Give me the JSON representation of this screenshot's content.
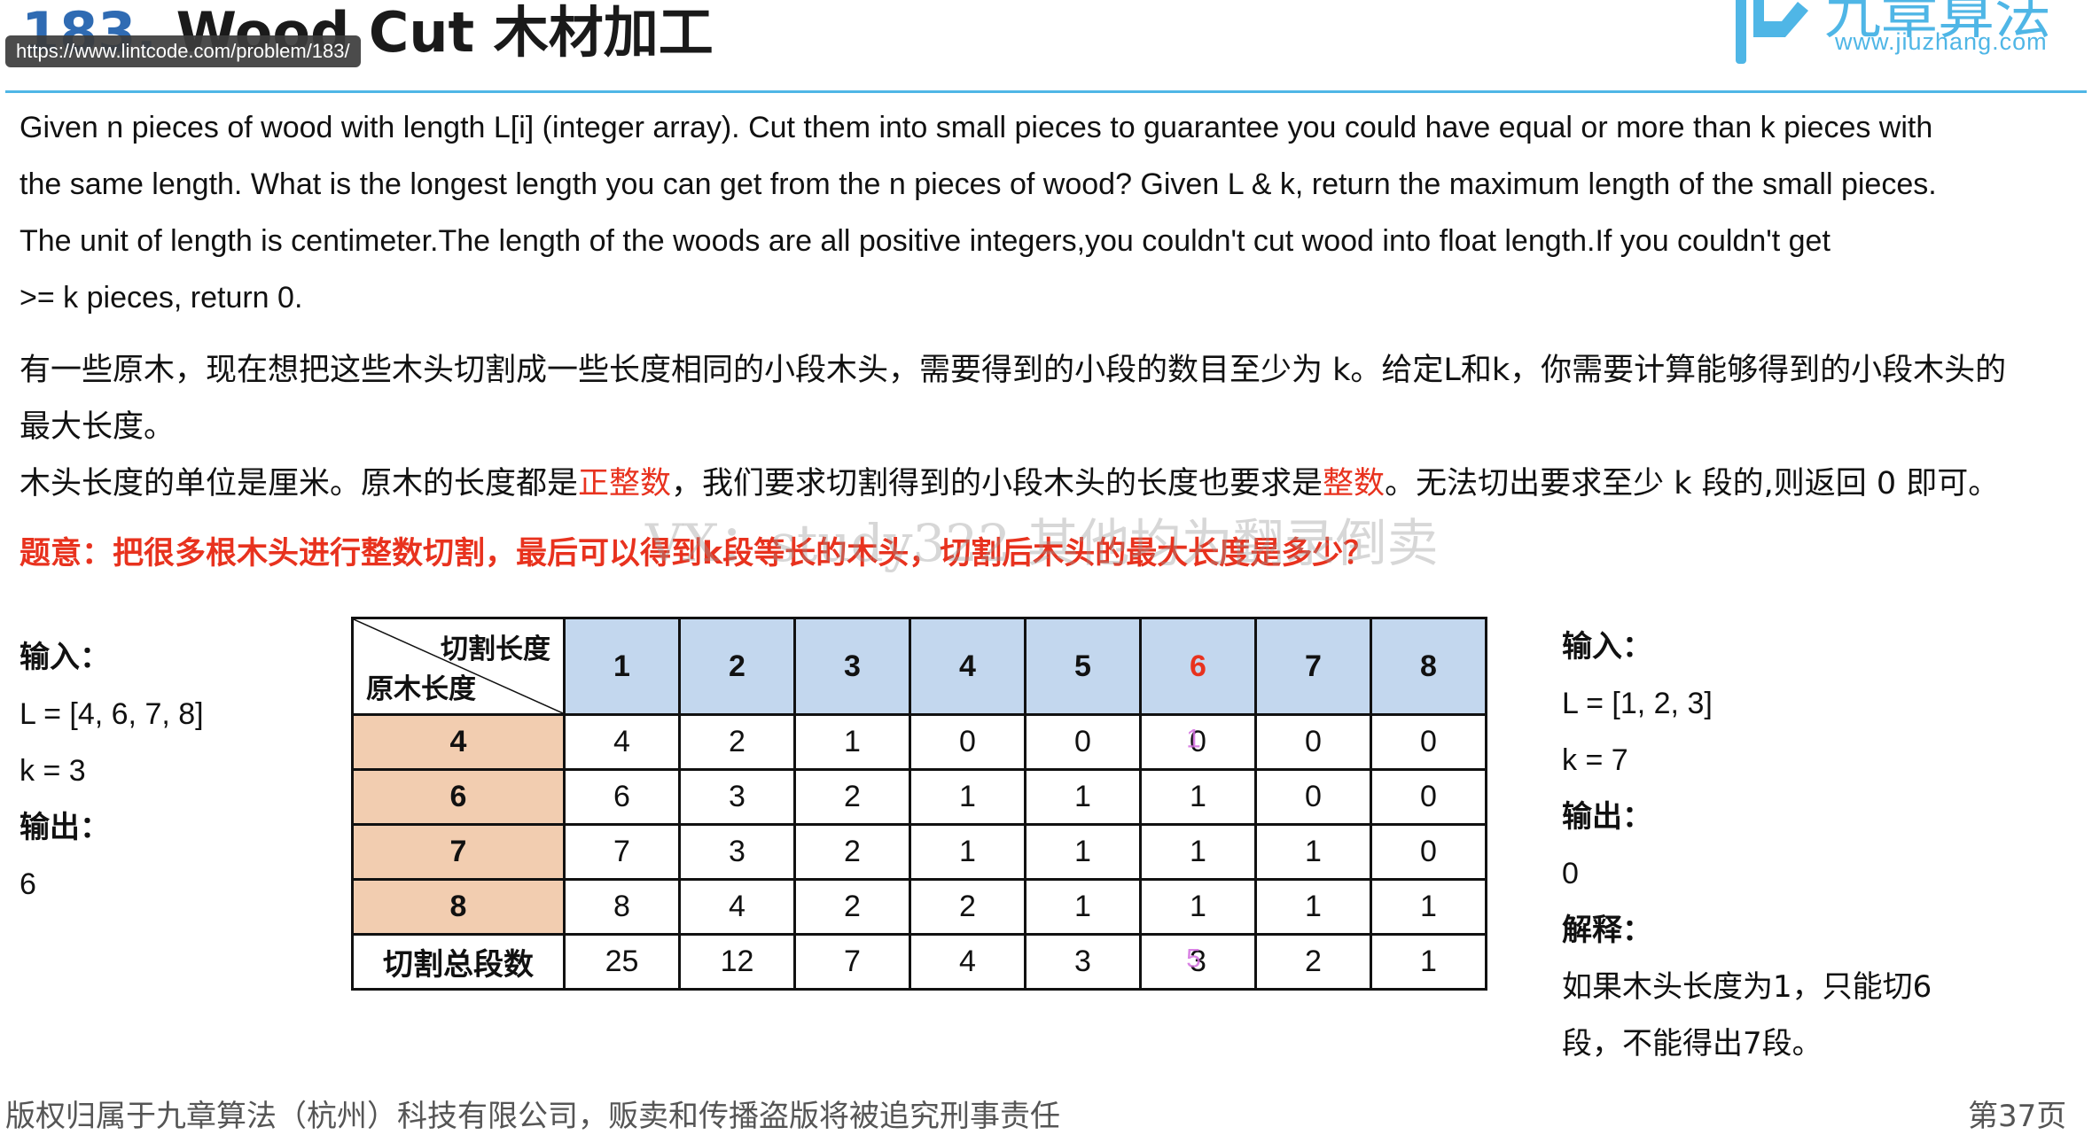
{
  "header": {
    "problem_number": "183.",
    "title_en": "Wood Cut",
    "title_cn": "木材加工",
    "url": "https://www.lintcode.com/problem/183/",
    "logo_cn": "九章算法",
    "logo_en": "www.jiuzhang.com",
    "accent": "#4fb6e6"
  },
  "description_en": [
    "Given n pieces of wood with length L[i] (integer array). Cut them into small pieces to guarantee you could have equal or more than k pieces with",
    "the same length. What is the longest length you can get from the n pieces of wood? Given L & k, return the maximum length of the small pieces.",
    "The unit of length is centimeter.The length of the woods are all positive integers,you couldn't cut wood into float length.If you couldn't get",
    ">= k pieces, return 0."
  ],
  "description_cn": {
    "line1": "有一些原木，现在想把这些木头切割成一些长度相同的小段木头，需要得到的小段的数目至少为 k。给定L和k，你需要计算能够得到的小段木头的",
    "line2": "最大长度。",
    "line3_a": "木头长度的单位是厘米。原木的长度都是",
    "line3_red1": "正整数",
    "line3_b": "，我们要求切割得到的小段木头的长度也要求是",
    "line3_red2": "整数",
    "line3_c": "。无法切出要求至少 k 段的,则返回 0 即可。",
    "summary": "题意：把很多根木头进行整数切割，最后可以得到k段等长的木头，切割后木头的最大长度是多少？"
  },
  "watermark": "VX：study322 其他均为翻录倒卖",
  "example1": {
    "input_label": "输入：",
    "L": "L = [4, 6, 7, 8]",
    "k": "k = 3",
    "output_label": "输出：",
    "output": "6"
  },
  "example2": {
    "input_label": "输入：",
    "L": "L = [1, 2, 3]",
    "k": "k = 7",
    "output_label": "输出：",
    "output": "0",
    "explain_label": "解释：",
    "explain_1": "如果木头长度为1，只能切6",
    "explain_2": "段，不能得出7段。"
  },
  "table": {
    "corner_top": "切割长度",
    "corner_bottom": "原木长度",
    "cut_lengths": [
      "1",
      "2",
      "3",
      "4",
      "5",
      "6",
      "7",
      "8"
    ],
    "highlight_col": 5,
    "rows": [
      {
        "length": "4",
        "counts": [
          "4",
          "2",
          "1",
          "0",
          "0",
          "0",
          "0",
          "0"
        ]
      },
      {
        "length": "6",
        "counts": [
          "6",
          "3",
          "2",
          "1",
          "1",
          "1",
          "0",
          "0"
        ]
      },
      {
        "length": "7",
        "counts": [
          "7",
          "3",
          "2",
          "1",
          "1",
          "1",
          "1",
          "0"
        ]
      },
      {
        "length": "8",
        "counts": [
          "8",
          "4",
          "2",
          "2",
          "1",
          "1",
          "1",
          "1"
        ]
      }
    ],
    "total_label": "切割总段数",
    "totals": [
      "25",
      "12",
      "7",
      "4",
      "3",
      "3",
      "2",
      "1"
    ],
    "ghost_marks": {
      "row0_col5": "1",
      "total_col5": "5"
    }
  },
  "footer": {
    "left": "版权归属于九章算法（杭州）科技有限公司，贩卖和传播盗版将被追究刑事责任",
    "right": "第37页"
  }
}
